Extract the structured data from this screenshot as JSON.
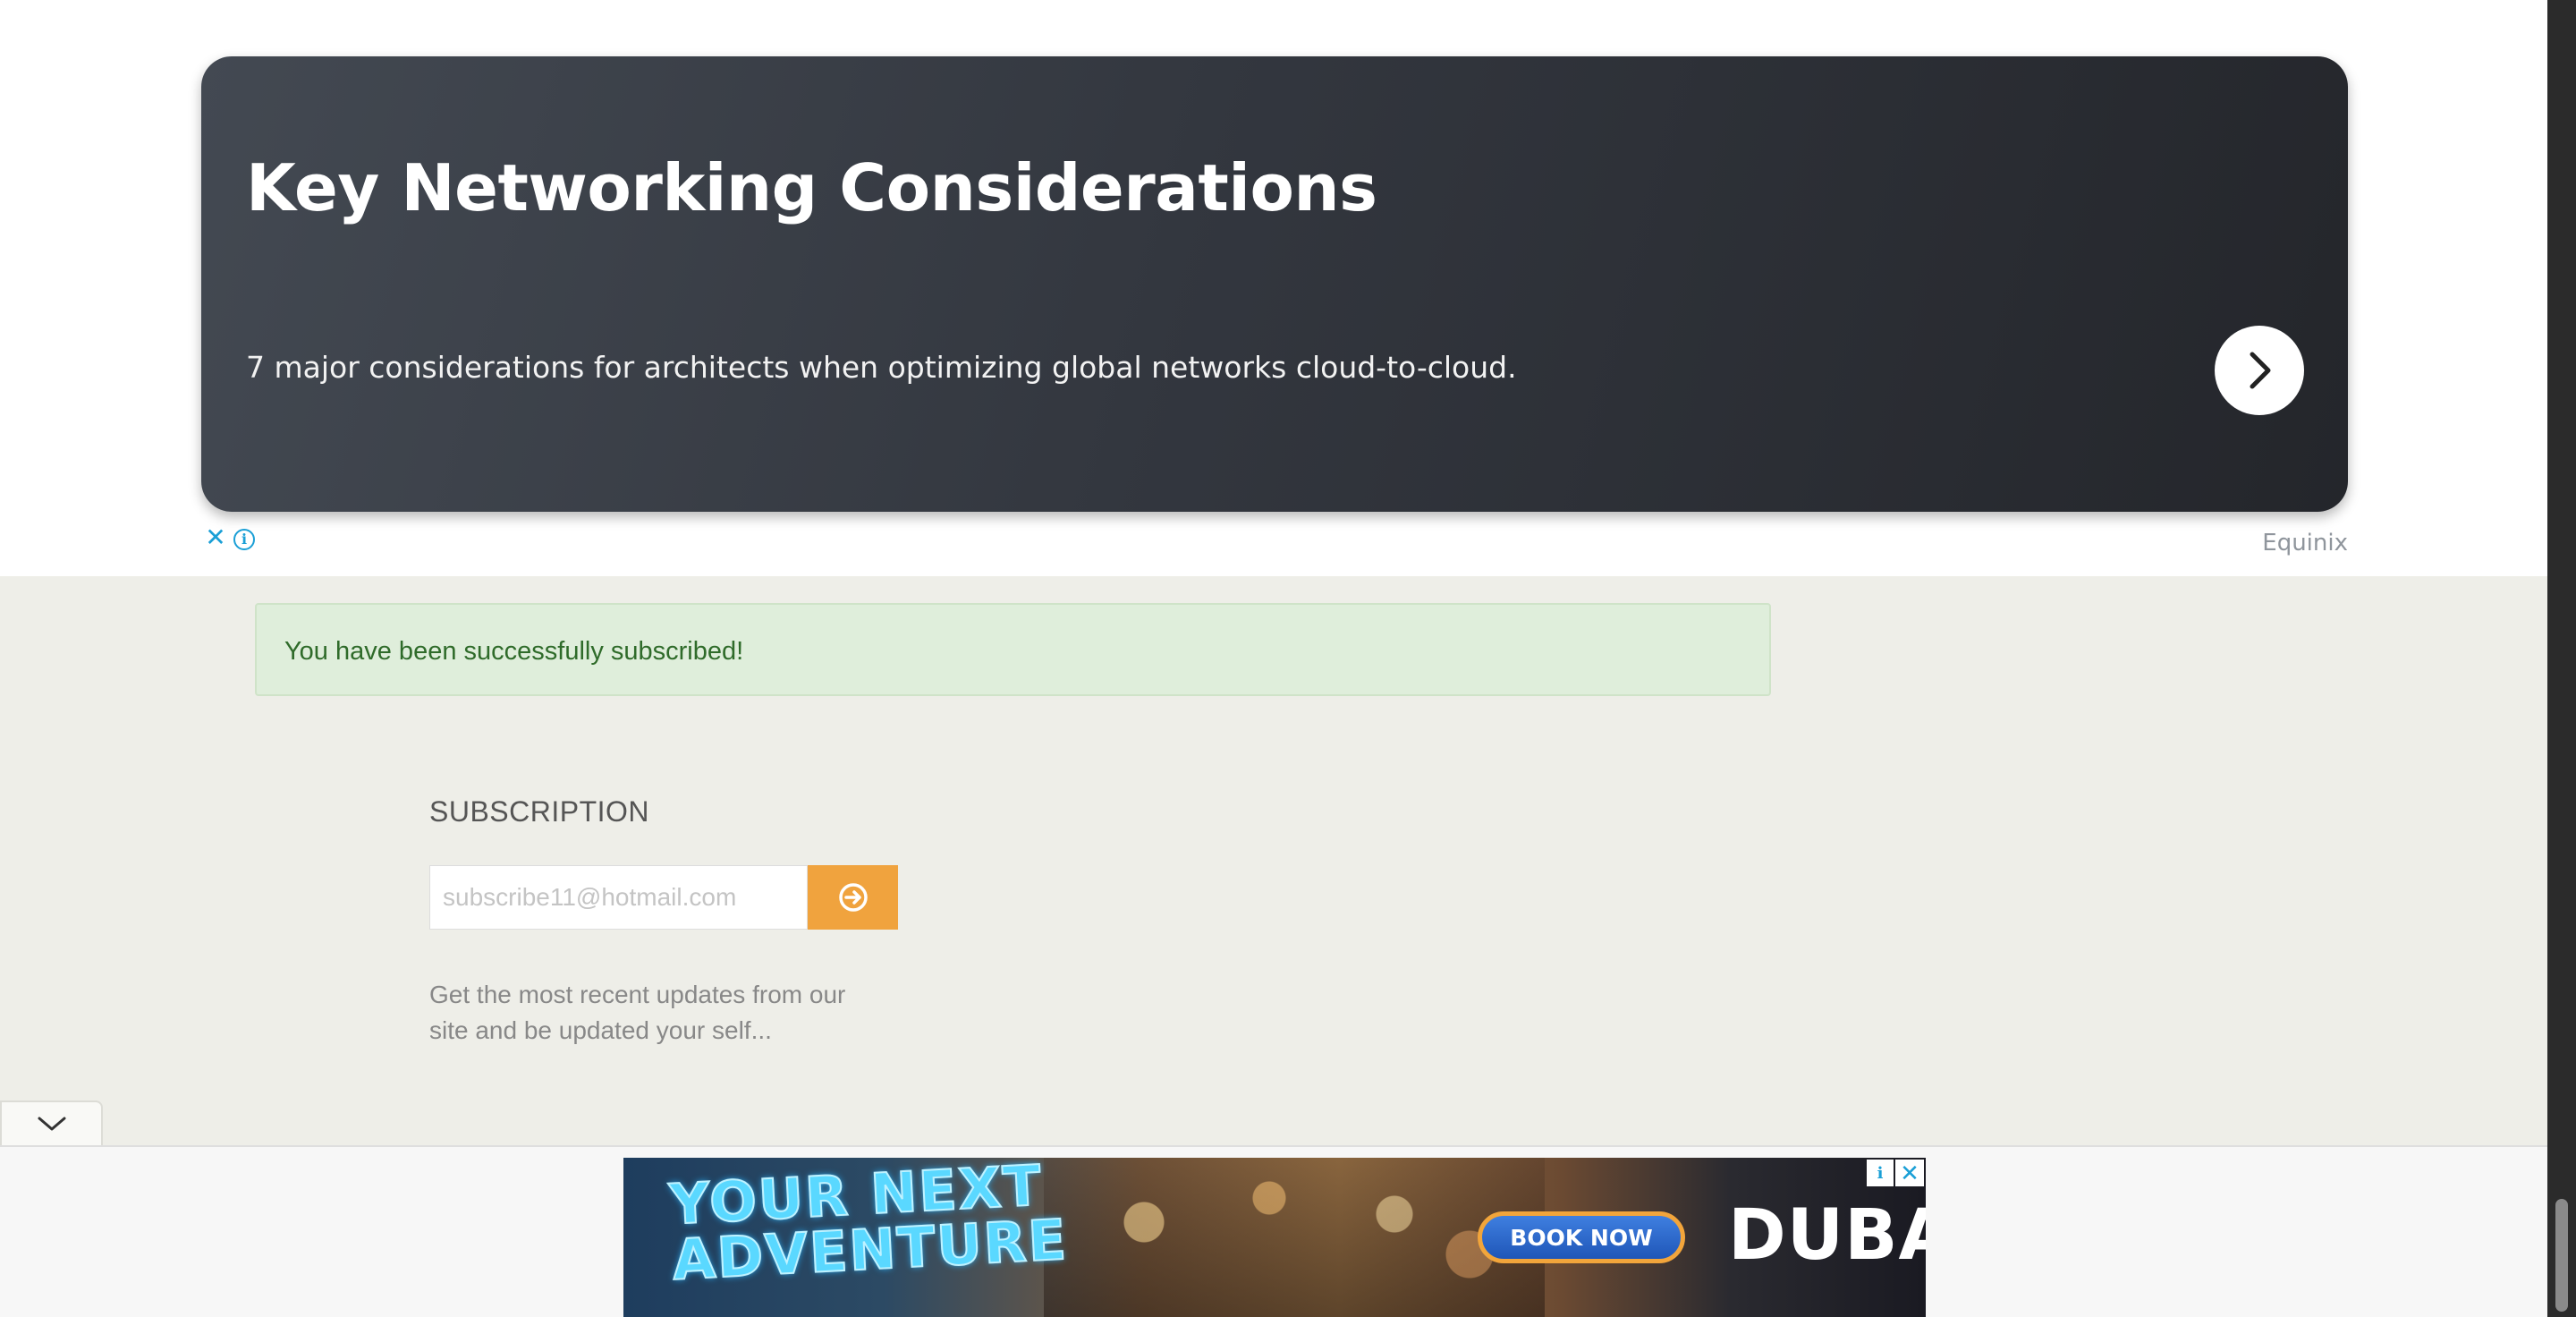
{
  "ad_top": {
    "title": "Key Networking Considerations",
    "description": "7 major considerations for architects when optimizing global networks cloud-to-cloud.",
    "sponsor": "Equinix",
    "arrow_icon": "chevron-right-icon",
    "close_glyph": "✕",
    "info_glyph": "i"
  },
  "alert": {
    "message": "You have been successfully subscribed!"
  },
  "subscription": {
    "heading": "SUBSCRIPTION",
    "email_placeholder": "subscribe11@hotmail.com",
    "submit_icon": "arrow-circle-right-icon",
    "description": "Get the most recent updates from our site and be updated your self..."
  },
  "collapse_icon": "chevron-down-icon",
  "bottom_ad": {
    "headline_line1": "YOUR NEXT",
    "headline_line2": "ADVENTURE",
    "cta": "BOOK NOW",
    "brand": "DUBAI",
    "info_glyph": "i",
    "close_glyph": "✕"
  },
  "colors": {
    "card_dark": "#33373f",
    "accent_orange": "#f0a33e",
    "alert_bg": "#dfeedb",
    "alert_text": "#2f6b2a",
    "ad_link_blue": "#1a9fd6",
    "content_bg": "#eeeee8"
  }
}
